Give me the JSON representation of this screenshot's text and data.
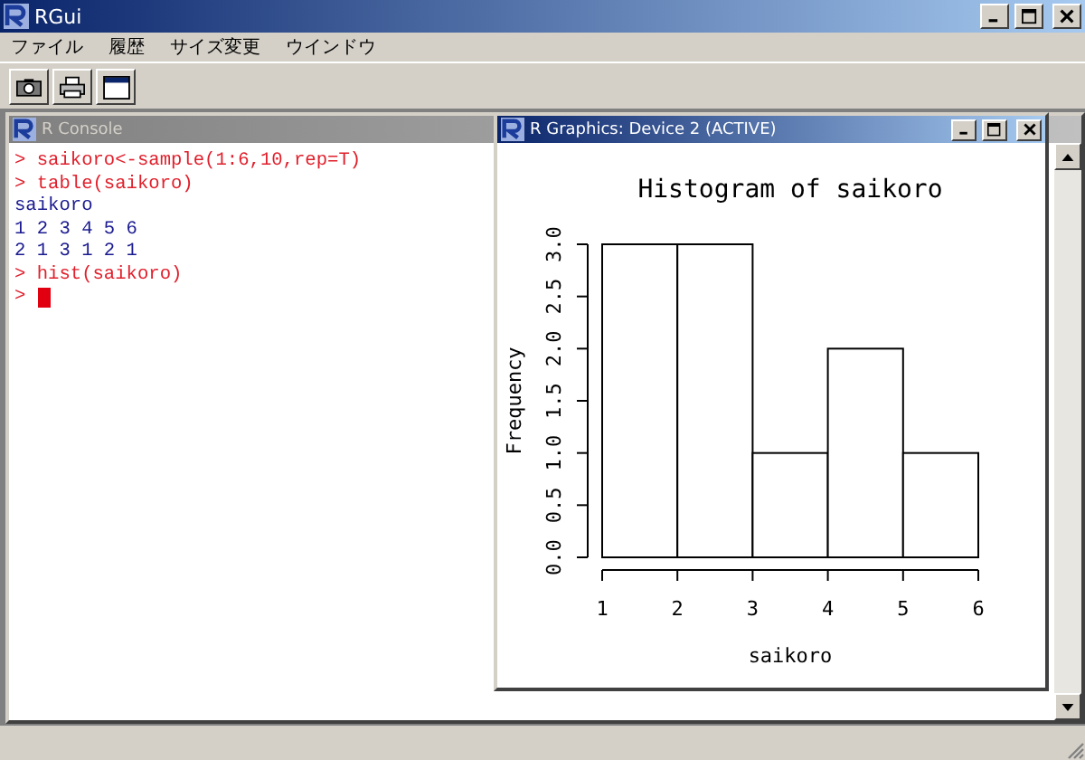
{
  "window": {
    "title": "RGui"
  },
  "menu": [
    "ファイル",
    "履歴",
    "サイズ変更",
    "ウインドウ"
  ],
  "toolbar": [
    {
      "kind": "camera"
    },
    {
      "kind": "printer"
    },
    {
      "kind": "window"
    }
  ],
  "console": {
    "title": "R Console",
    "lines": [
      {
        "kind": "input",
        "prompt": ">",
        "text": "saikoro<-sample(1:6,10,rep=T)"
      },
      {
        "kind": "input",
        "prompt": ">",
        "text": "table(saikoro)"
      },
      {
        "kind": "output",
        "text": "saikoro"
      },
      {
        "kind": "output",
        "text": "1 2 3 4 5 6"
      },
      {
        "kind": "output",
        "text": "2 1 3 1 2 1"
      },
      {
        "kind": "input",
        "prompt": ">",
        "text": "hist(saikoro)"
      },
      {
        "kind": "cursor",
        "prompt": ">"
      }
    ]
  },
  "graphics": {
    "title": "R Graphics: Device 2 (ACTIVE)",
    "chart_data": {
      "type": "bar",
      "title": "Histogram of saikoro",
      "xlabel": "saikoro",
      "ylabel": "Frequency",
      "x": [
        1.5,
        2.5,
        3.5,
        4.5,
        5.5
      ],
      "values": [
        3,
        3,
        1,
        2,
        1
      ],
      "xlim": [
        1,
        6
      ],
      "ylim": [
        0,
        3
      ],
      "xticks": [
        1,
        2,
        3,
        4,
        5,
        6
      ],
      "yticks": [
        {
          "value": 0,
          "label": "0.0"
        },
        {
          "value": 0.5,
          "label": "0.5"
        },
        {
          "value": 1,
          "label": "1.0"
        },
        {
          "value": 1.5,
          "label": "1.5"
        },
        {
          "value": 2,
          "label": "2.0"
        },
        {
          "value": 2.5,
          "label": "2.5"
        },
        {
          "value": 3,
          "label": "3.0"
        }
      ]
    }
  }
}
